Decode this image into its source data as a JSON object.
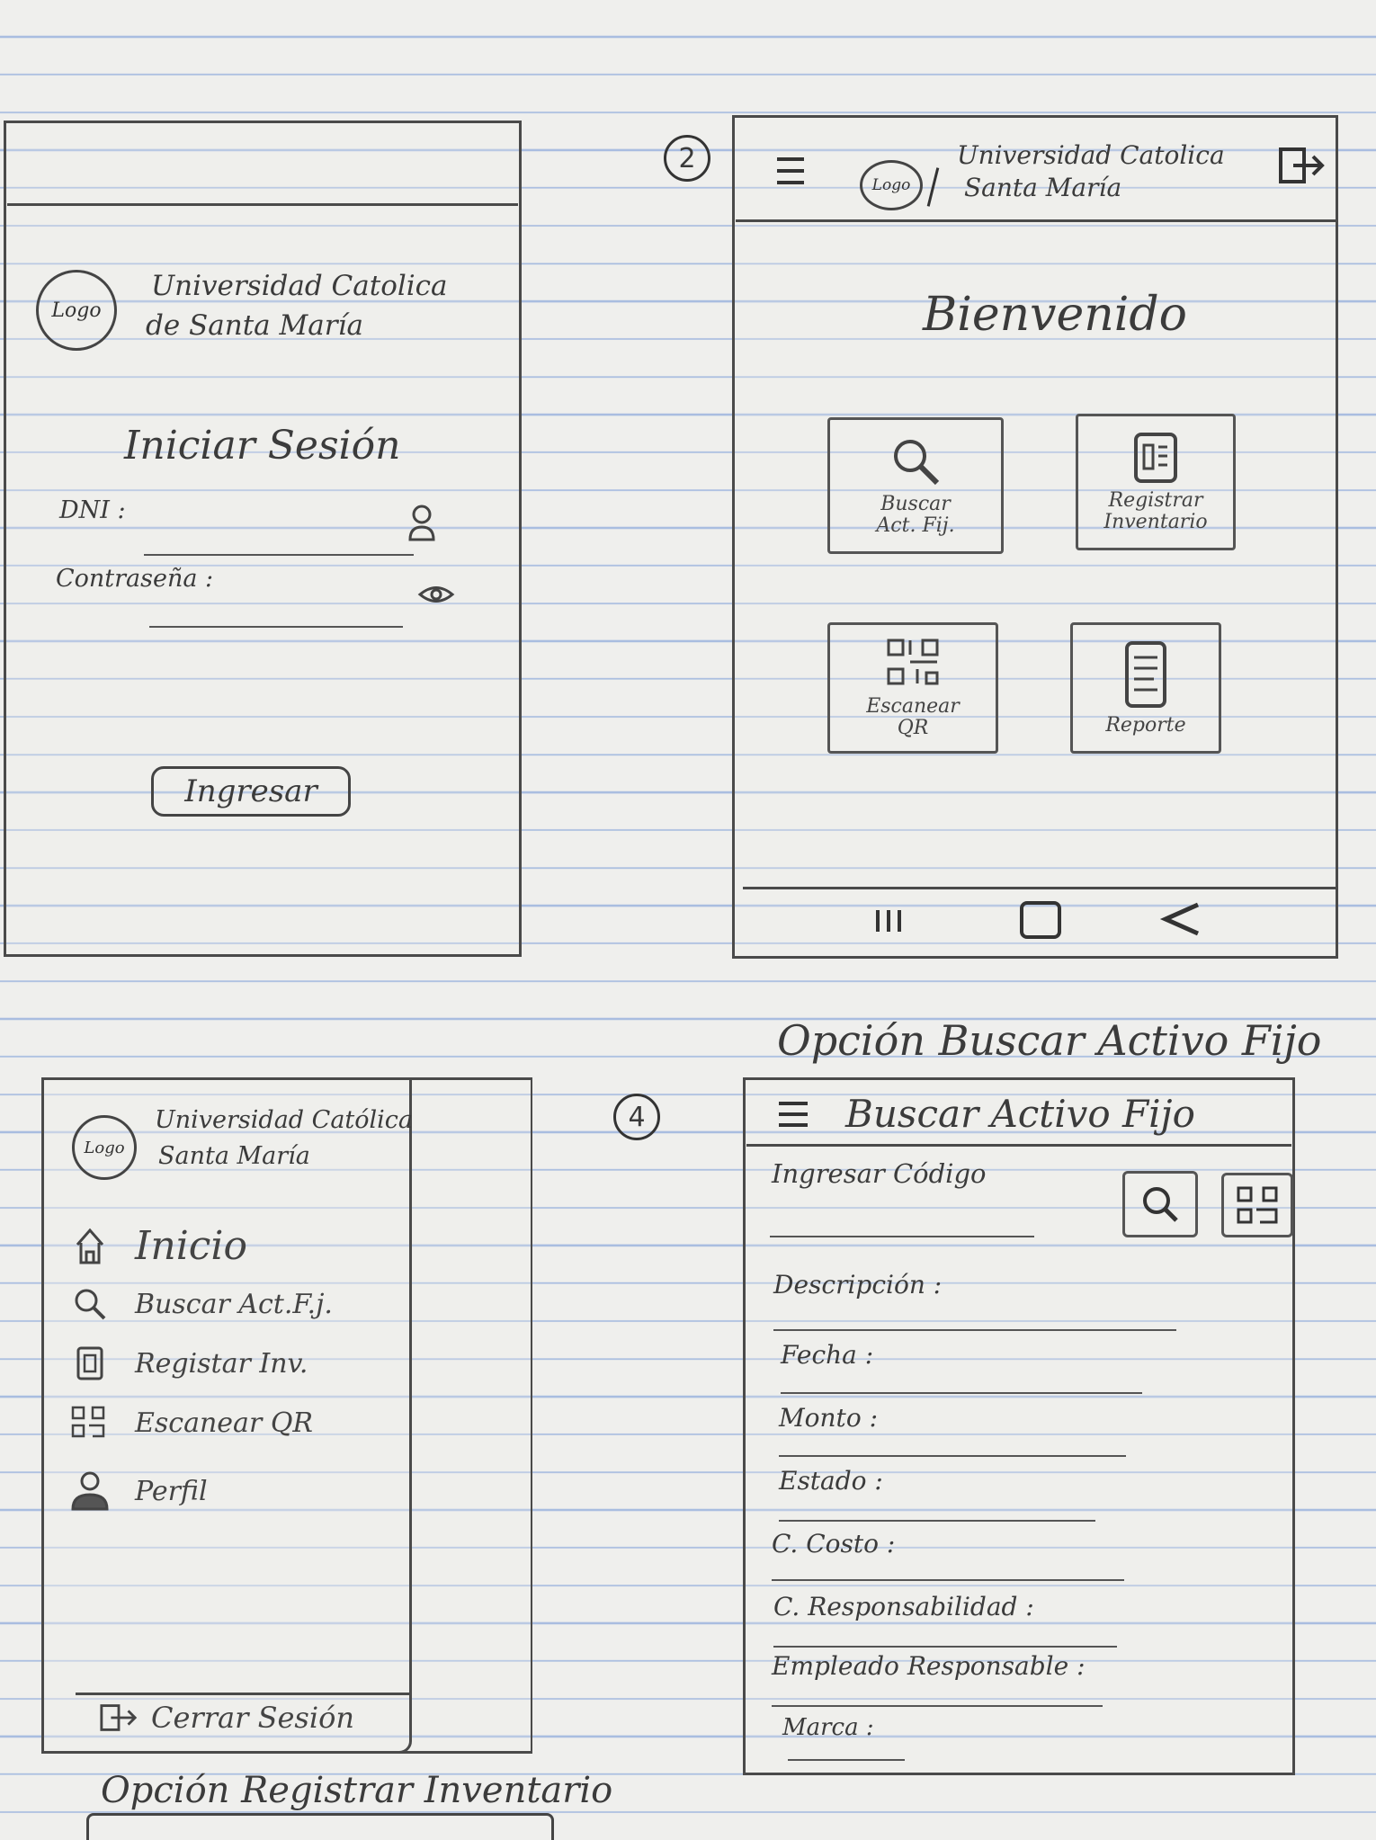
{
  "screen1": {
    "logo": "Logo",
    "university": [
      "Universidad Catolica",
      "de Santa María"
    ],
    "title": "Iniciar Sesión",
    "dni_label": "DNI :",
    "password_label": "Contraseña :",
    "submit": "Ingresar"
  },
  "screen2": {
    "number": "2",
    "logo": "Logo",
    "university": [
      "Universidad Catolica",
      "Santa María"
    ],
    "welcome": "Bienvenido",
    "tiles": [
      {
        "label": "Buscar Act. Fij.",
        "icon": "search-icon"
      },
      {
        "label": "Registrar Inventario",
        "icon": "document-icon"
      },
      {
        "label": "Escanear QR",
        "icon": "qr-icon"
      },
      {
        "label": "Reporte",
        "icon": "report-icon"
      }
    ]
  },
  "screen3": {
    "logo": "Logo",
    "university": [
      "Universidad Católica",
      "Santa María"
    ],
    "menu": [
      {
        "label": "Inicio",
        "icon": "home-icon"
      },
      {
        "label": "Buscar Act.F.j.",
        "icon": "search-icon"
      },
      {
        "label": "Registar Inv.",
        "icon": "document-icon"
      },
      {
        "label": "Escanear QR",
        "icon": "qr-icon"
      },
      {
        "label": "Perfil",
        "icon": "user-icon"
      }
    ],
    "logout": "Cerrar Sesión"
  },
  "screen4": {
    "caption": "Opción Buscar Activo Fijo",
    "number": "4",
    "title": "Buscar Activo Fijo",
    "code_label": "Ingresar Código",
    "fields": [
      "Descripción :",
      "Fecha :",
      "Monto :",
      "Estado :",
      "C. Costo :",
      "C. Responsabilidad :",
      "Empleado Responsable :",
      "Marca :"
    ]
  },
  "footer_caption": "Opción Registrar Inventario"
}
